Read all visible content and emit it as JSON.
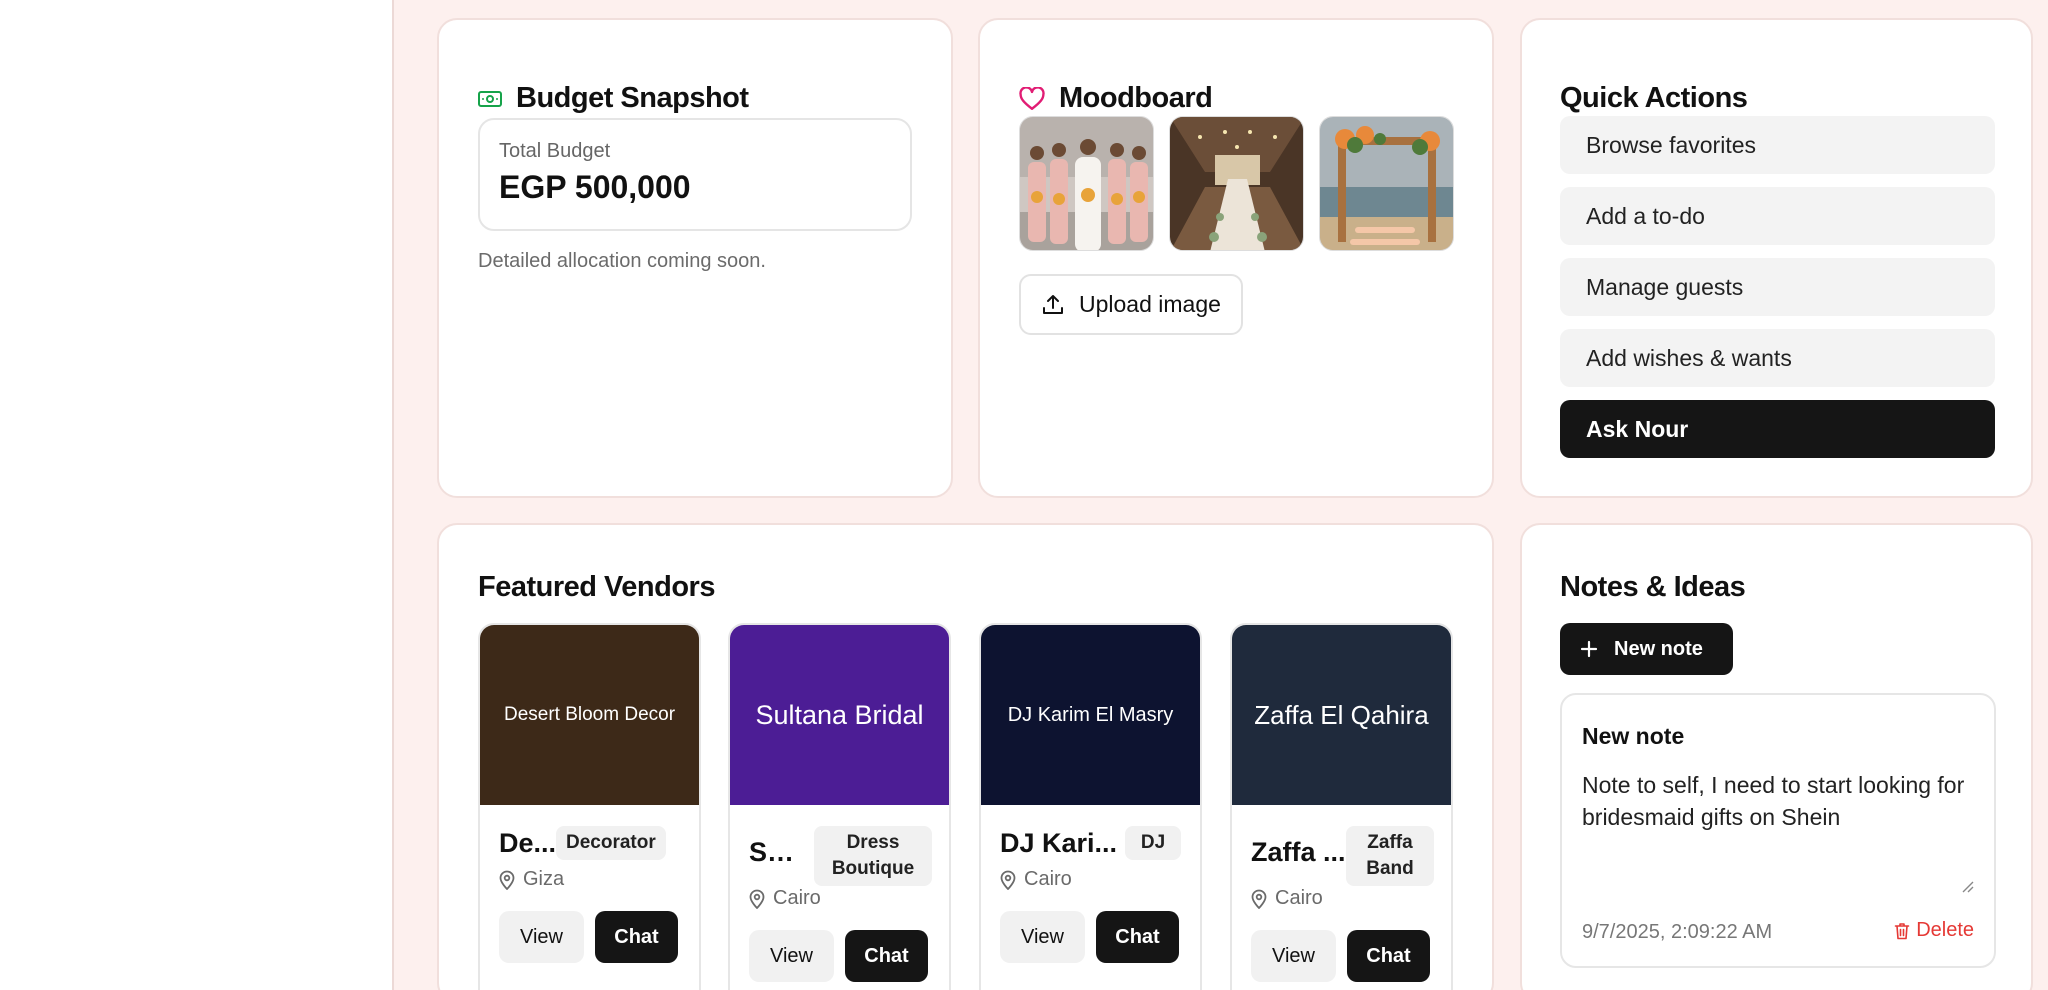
{
  "budget": {
    "title": "Budget Snapshot",
    "total_label": "Total Budget",
    "total_value": "EGP 500,000",
    "note": "Detailed allocation coming soon."
  },
  "moodboard": {
    "title": "Moodboard",
    "upload_label": "Upload image",
    "images": [
      "bridesmaids-photo",
      "reception-hall-photo",
      "floral-arch-photo"
    ]
  },
  "quick_actions": {
    "title": "Quick Actions",
    "items": [
      "Browse favorites",
      "Add a to-do",
      "Manage guests",
      "Add wishes & wants",
      "Ask Nour"
    ]
  },
  "vendors": {
    "title": "Featured Vendors",
    "view_label": "View",
    "chat_label": "Chat",
    "items": [
      {
        "banner": "Desert Bloom Decor",
        "name": "De...",
        "tag": "Decorator",
        "location": "Giza",
        "color": "#3d2918"
      },
      {
        "banner": "Sultana Bridal",
        "name": "Sul...",
        "tag": "Dress Boutique",
        "location": "Cairo",
        "color": "#4c1d95"
      },
      {
        "banner": "DJ Karim El Masry",
        "name": "DJ Kari...",
        "tag": "DJ",
        "location": "Cairo",
        "color": "#0d1330"
      },
      {
        "banner": "Zaffa El Qahira",
        "name": "Zaffa ...",
        "tag": "Zaffa Band",
        "location": "Cairo",
        "color": "#1f2a3c"
      }
    ]
  },
  "notes": {
    "title": "Notes & Ideas",
    "new_label": "New note",
    "card": {
      "title": "New note",
      "body": "Note to self, I need to start looking for bridesmaid gifts on Shein",
      "timestamp": "9/7/2025, 2:09:22 AM",
      "delete_label": "Delete"
    }
  },
  "colors": {
    "background": "#fdf0ee",
    "accent_dark": "#151515",
    "budget_icon": "#16a34a",
    "heart_icon": "#e11d74",
    "delete": "#e53935"
  }
}
